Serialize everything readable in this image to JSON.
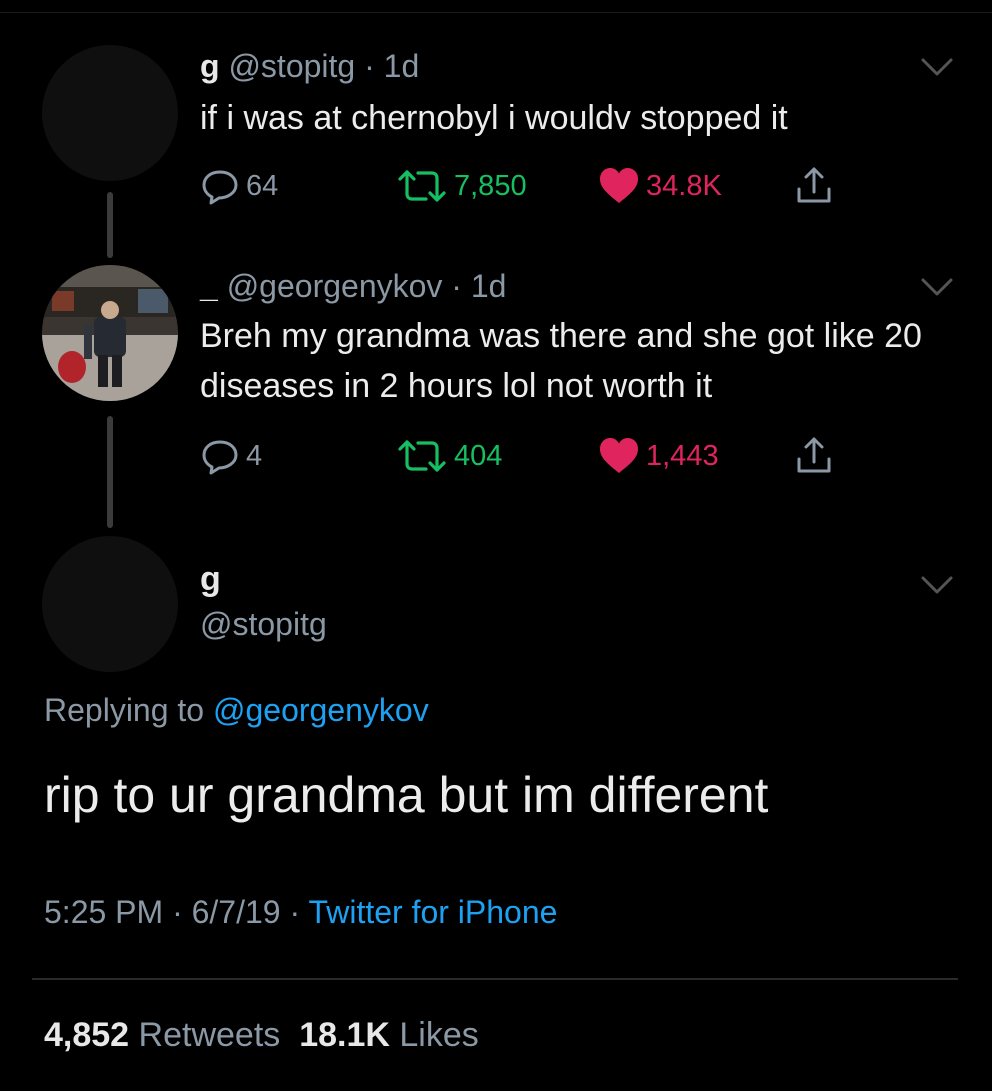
{
  "thread": [
    {
      "name": "g",
      "handle": "@stopitg",
      "separator": "·",
      "time": "1d",
      "text": "if i was at chernobyl i wouldv stopped it",
      "actions": {
        "replies": "64",
        "retweets": "7,850",
        "likes": "34.8K"
      }
    },
    {
      "name": "_",
      "handle": "@georgenykov",
      "separator": "·",
      "time": "1d",
      "text": "Breh my grandma was there and she got like 20 diseases in 2 hours lol not worth it",
      "actions": {
        "replies": "4",
        "retweets": "404",
        "likes": "1,443"
      }
    }
  ],
  "main_tweet": {
    "name": "g",
    "handle": "@stopitg",
    "replying_prefix": "Replying to",
    "replying_to": "@georgenykov",
    "text": "rip to ur grandma but im different",
    "time": "5:25 PM",
    "date": "6/7/19",
    "separator": "·",
    "source": "Twitter for iPhone",
    "retweet_count": "4,852",
    "retweet_label": "Retweets",
    "like_count": "18.1K",
    "like_label": "Likes"
  },
  "icons": {
    "reply": "reply-icon",
    "retweet": "retweet-icon",
    "like": "heart-icon",
    "share": "share-icon",
    "menu": "chevron-down-icon"
  },
  "colors": {
    "background": "#000000",
    "secondary_text": "#8b98a5",
    "link": "#1da1f2",
    "retweet": "#17bf63",
    "like": "#e0245e"
  }
}
